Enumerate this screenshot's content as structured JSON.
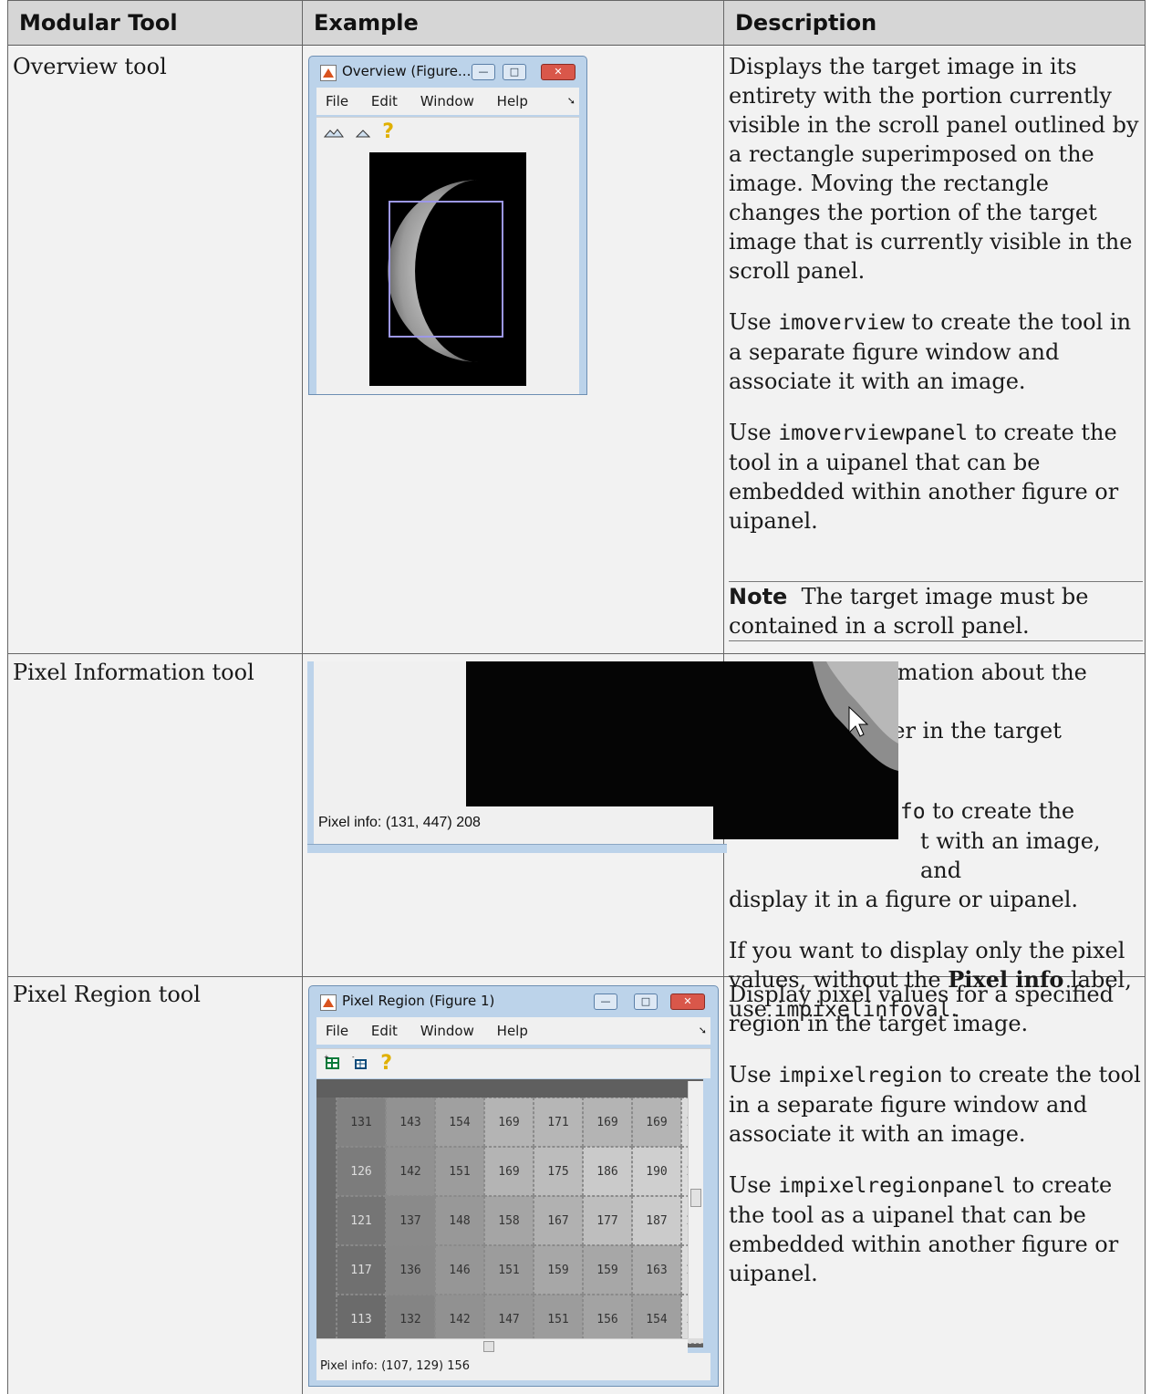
{
  "headers": {
    "col1": "Modular Tool",
    "col2": "Example",
    "col3": "Description"
  },
  "rows": {
    "overview": {
      "name": "Overview tool",
      "window": {
        "title": "Overview (Figure...",
        "menus": [
          "File",
          "Edit",
          "Window",
          "Help"
        ],
        "toolbar_icons": [
          "mountain-large-icon",
          "mountain-small-icon",
          "help-icon"
        ]
      },
      "desc_p1": "Displays the target image in its entirety with the portion currently visible in the scroll panel outlined by a rectangle superimposed on the image. Moving the rectangle changes the portion of the target image that is currently visible in the scroll panel.",
      "desc_p2_pre": "Use ",
      "desc_p2_code": "imoverview",
      "desc_p2_post": " to create the tool in a separate figure window and associate it with an image.",
      "desc_p3_pre": "Use ",
      "desc_p3_code": "imoverviewpanel",
      "desc_p3_post": " to create the tool in a uipanel that can be embedded within another figure or uipanel.",
      "note_label": "Note",
      "note_text": "The target image must be contained in a scroll panel."
    },
    "pixel_info": {
      "name": "Pixel Information tool",
      "readout": "Pixel info: (131, 447)  208",
      "desc_p1_visible": "plays information about the pixel",
      "desc_p1_line2_a": "use is over in the target",
      "desc_p2_code_fragment": "nfo",
      "desc_p2_after": " to create the",
      "desc_p2_line2": "t with an image, and",
      "desc_p2_line3": "display it in a figure or uipanel.",
      "desc_p3_pre": "If you want to display only the pixel values, without the ",
      "desc_p3_bold": "Pixel info",
      "desc_p3_mid": " label, use ",
      "desc_p3_code": "impixelinfoval",
      "desc_p3_post": "."
    },
    "pixel_region": {
      "name": "Pixel Region tool",
      "window": {
        "title": "Pixel Region (Figure 1)",
        "menus": [
          "File",
          "Edit",
          "Window",
          "Help"
        ],
        "toolbar_icons": [
          "add-grid-icon",
          "remove-grid-icon",
          "help-icon"
        ],
        "grid": [
          [
            "131",
            "143",
            "154",
            "169",
            "171",
            "169",
            "169"
          ],
          [
            "126",
            "142",
            "151",
            "169",
            "175",
            "186",
            "190"
          ],
          [
            "121",
            "137",
            "148",
            "158",
            "167",
            "177",
            "187"
          ],
          [
            "117",
            "136",
            "146",
            "151",
            "159",
            "159",
            "163"
          ],
          [
            "113",
            "132",
            "142",
            "147",
            "151",
            "156",
            "154"
          ]
        ],
        "readout": "Pixel info: (107, 129)  156"
      },
      "desc_p1": "Display pixel values for a specified region in the target image.",
      "desc_p2_pre": "Use ",
      "desc_p2_code": "impixelregion",
      "desc_p2_post": " to create the tool in a separate figure window and associate it with an image.",
      "desc_p3_pre": "Use ",
      "desc_p3_code": "impixelregionpanel",
      "desc_p3_post": " to create the tool as a uipanel that can be embedded within another figure or uipanel."
    }
  }
}
